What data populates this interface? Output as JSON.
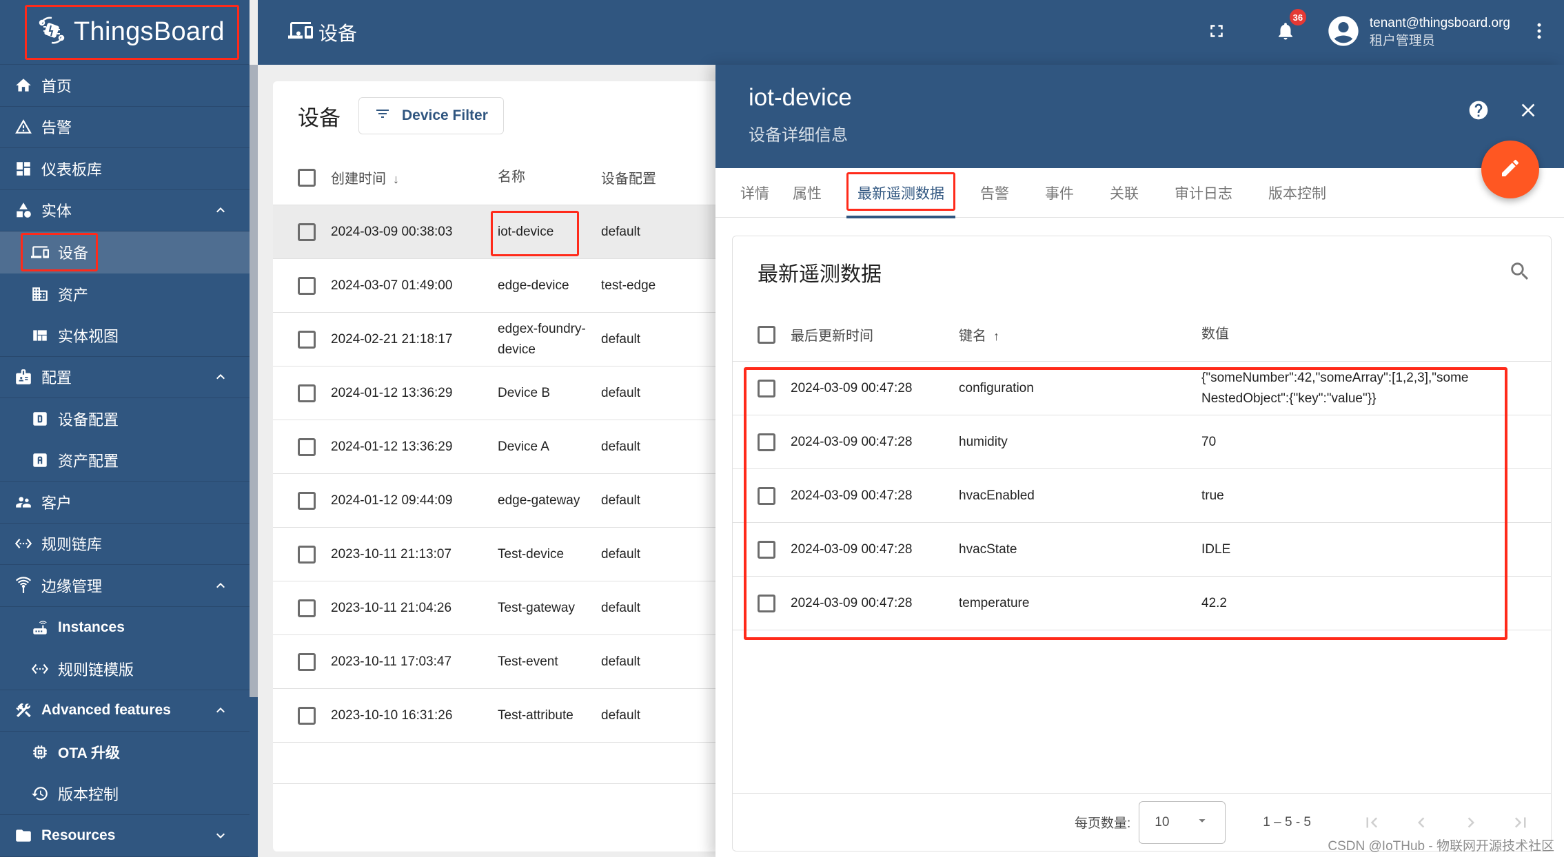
{
  "app": {
    "logo_text": "ThingsBoard",
    "page_title": "设备"
  },
  "header": {
    "notification_count": "36",
    "user_email": "tenant@thingsboard.org",
    "user_role": "租户管理员"
  },
  "sidebar": {
    "items": [
      {
        "label": "首页",
        "icon": "home-icon",
        "level": "top"
      },
      {
        "label": "告警",
        "icon": "warning-icon",
        "level": "top"
      },
      {
        "label": "仪表板库",
        "icon": "dashboard-icon",
        "level": "top"
      },
      {
        "label": "实体",
        "icon": "entity-icon",
        "level": "top",
        "expanded": true
      },
      {
        "label": "设备",
        "icon": "devices-icon",
        "level": "sub",
        "active": true
      },
      {
        "label": "资产",
        "icon": "domain-icon",
        "level": "sub"
      },
      {
        "label": "实体视图",
        "icon": "view-quilt-icon",
        "level": "sub"
      },
      {
        "label": "配置",
        "icon": "badge-icon",
        "level": "top",
        "expanded": true
      },
      {
        "label": "设备配置",
        "icon": "device-profile-icon",
        "level": "sub"
      },
      {
        "label": "资产配置",
        "icon": "asset-profile-icon",
        "level": "sub"
      },
      {
        "label": "客户",
        "icon": "supervisor-account-icon",
        "level": "top"
      },
      {
        "label": "规则链库",
        "icon": "settings-ethernet-icon",
        "level": "top"
      },
      {
        "label": "边缘管理",
        "icon": "edge-icon",
        "level": "top",
        "expanded": true
      },
      {
        "label": "Instances",
        "icon": "router-icon",
        "level": "sub"
      },
      {
        "label": "规则链模版",
        "icon": "settings-ethernet-icon",
        "level": "sub"
      },
      {
        "label": "Advanced features",
        "icon": "construction-icon",
        "level": "top",
        "expanded": true
      },
      {
        "label": "OTA 升级",
        "icon": "memory-icon",
        "level": "sub"
      },
      {
        "label": "版本控制",
        "icon": "history-icon",
        "level": "sub"
      },
      {
        "label": "Resources",
        "icon": "folder-icon",
        "level": "top",
        "expanded": false
      }
    ]
  },
  "device_list": {
    "title": "设备",
    "filter_label": "Device Filter",
    "columns": [
      "创建时间",
      "名称",
      "设备配置"
    ],
    "sort_column": "创建时间",
    "sort_direction": "desc",
    "rows": [
      {
        "created": "2024-03-09 00:38:03",
        "name": "iot-device",
        "profile": "default",
        "selected": true
      },
      {
        "created": "2024-03-07 01:49:00",
        "name": "edge-device",
        "profile": "test-edge"
      },
      {
        "created": "2024-02-21 21:18:17",
        "name": "edgex-foundry-device",
        "profile": "default"
      },
      {
        "created": "2024-01-12 13:36:29",
        "name": "Device B",
        "profile": "default"
      },
      {
        "created": "2024-01-12 13:36:29",
        "name": "Device A",
        "profile": "default"
      },
      {
        "created": "2024-01-12 09:44:09",
        "name": "edge-gateway",
        "profile": "default"
      },
      {
        "created": "2023-10-11 21:13:07",
        "name": "Test-device",
        "profile": "default"
      },
      {
        "created": "2023-10-11 21:04:26",
        "name": "Test-gateway",
        "profile": "default"
      },
      {
        "created": "2023-10-11 17:03:47",
        "name": "Test-event",
        "profile": "default"
      },
      {
        "created": "2023-10-10 16:31:26",
        "name": "Test-attribute",
        "profile": "default"
      }
    ]
  },
  "detail": {
    "title": "iot-device",
    "subtitle": "设备详细信息",
    "tabs": [
      "详情",
      "属性",
      "最新遥测数据",
      "告警",
      "事件",
      "关联",
      "审计日志",
      "版本控制"
    ],
    "active_tab": "最新遥测数据",
    "telemetry": {
      "title": "最新遥测数据",
      "columns": [
        "最后更新时间",
        "键名",
        "数值"
      ],
      "sort_column": "键名",
      "sort_direction": "asc",
      "rows": [
        {
          "ts": "2024-03-09 00:47:28",
          "key": "configuration",
          "value": "{\"someNumber\":42,\"someArray\":[1,2,3],\"someNestedObject\":{\"key\":\"value\"}}"
        },
        {
          "ts": "2024-03-09 00:47:28",
          "key": "humidity",
          "value": "70"
        },
        {
          "ts": "2024-03-09 00:47:28",
          "key": "hvacEnabled",
          "value": "true"
        },
        {
          "ts": "2024-03-09 00:47:28",
          "key": "hvacState",
          "value": "IDLE"
        },
        {
          "ts": "2024-03-09 00:47:28",
          "key": "temperature",
          "value": "42.2"
        }
      ],
      "pagination": {
        "page_size_label": "每页数量:",
        "page_size": "10",
        "range": "1 – 5 - 5"
      }
    }
  },
  "watermark": "CSDN @IoTHub - 物联网开源技术社区",
  "colors": {
    "primary": "#305680",
    "accent": "#ff5722",
    "highlight": "#ff2a1a",
    "badge": "#e53935"
  }
}
